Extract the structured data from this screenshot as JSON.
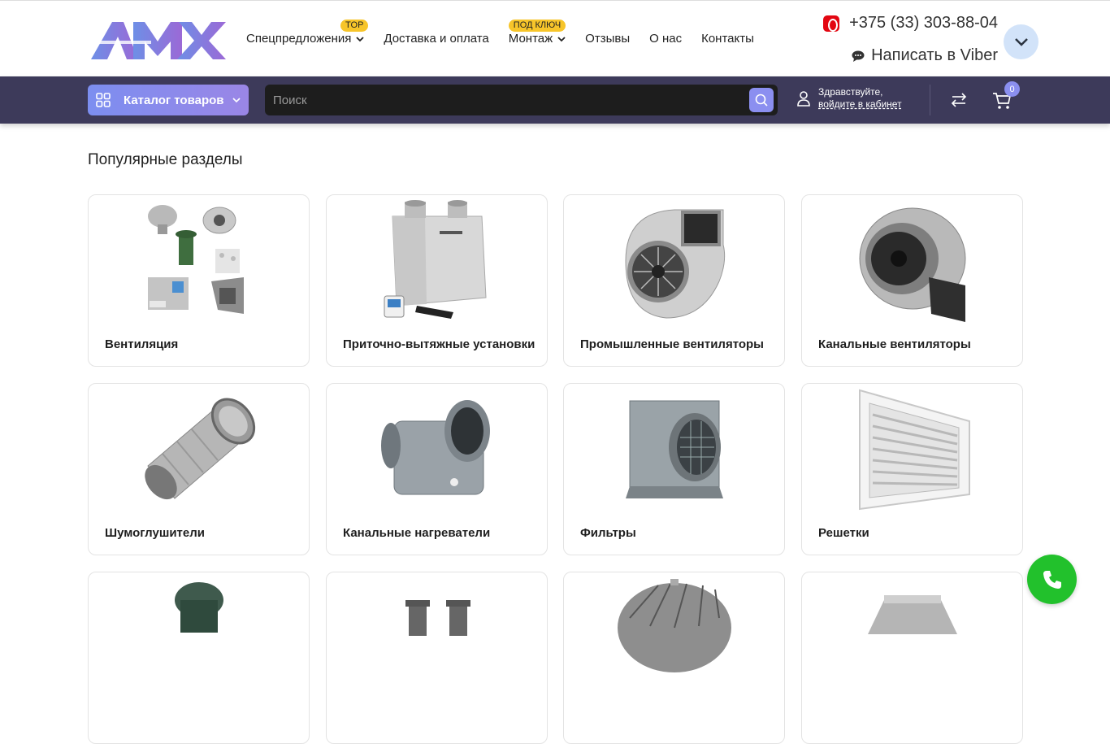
{
  "header": {
    "logo_text": "AMX",
    "nav": [
      {
        "label": "Спецпредложения",
        "badge": "TOP",
        "dropdown": true
      },
      {
        "label": "Доставка и оплата",
        "badge": "",
        "dropdown": false
      },
      {
        "label": "Монтаж",
        "badge": "ПОД КЛЮЧ",
        "dropdown": true
      },
      {
        "label": "Отзывы",
        "badge": "",
        "dropdown": false
      },
      {
        "label": "О нас",
        "badge": "",
        "dropdown": false
      },
      {
        "label": "Контакты",
        "badge": "",
        "dropdown": false
      }
    ],
    "phone": "+375 (33) 303-88-04",
    "viber": "Написать в Viber"
  },
  "toolbar": {
    "catalog_label": "Каталог товаров",
    "search_placeholder": "Поиск",
    "greeting": "Здравствуйте,",
    "login_link": "войдите в кабинет",
    "cart_count": "0"
  },
  "main": {
    "section_title": "Популярные разделы",
    "categories": [
      {
        "label": "Вентиляция",
        "icon": "ventilation-set"
      },
      {
        "label": "Приточно-вытяжные установки",
        "icon": "air-handling-unit"
      },
      {
        "label": "Промышленные вентиляторы",
        "icon": "industrial-fan"
      },
      {
        "label": "Канальные вентиляторы",
        "icon": "duct-fan"
      },
      {
        "label": "Шумоглушители",
        "icon": "silencer"
      },
      {
        "label": "Канальные нагреватели",
        "icon": "duct-heater"
      },
      {
        "label": "Фильтры",
        "icon": "filter-box"
      },
      {
        "label": "Решетки",
        "icon": "grille"
      },
      {
        "label": "",
        "icon": "roof-deflector"
      },
      {
        "label": "",
        "icon": "vent-outlets"
      },
      {
        "label": "",
        "icon": "turbo-deflector"
      },
      {
        "label": "",
        "icon": "duct-reducer"
      }
    ]
  },
  "colors": {
    "bar": "#3d3a5a",
    "accent": "#8b8ff0",
    "badge": "#f7c52a",
    "call": "#22c12c"
  }
}
